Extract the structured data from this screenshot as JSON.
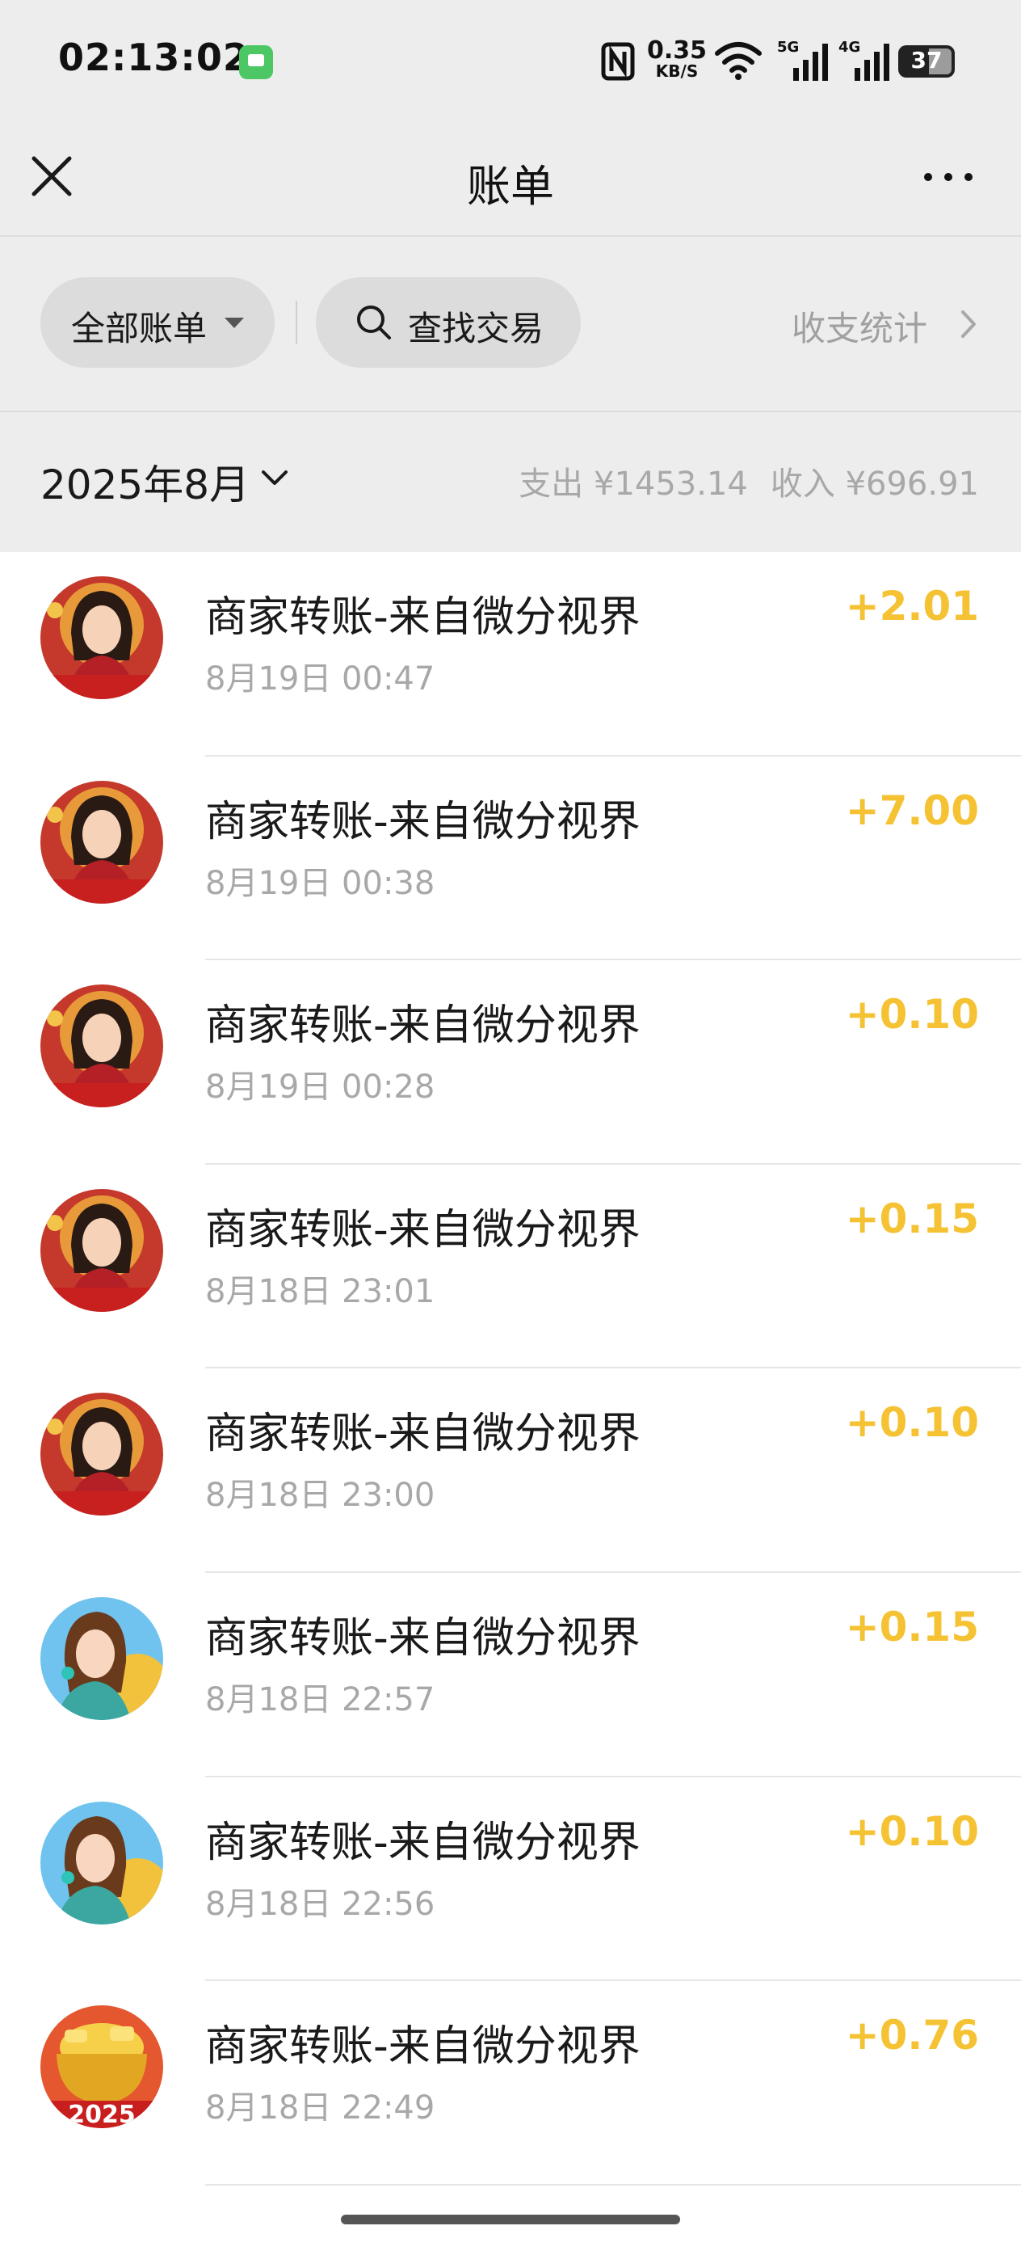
{
  "status_bar": {
    "time": "02:13:02",
    "net_speed_value": "0.35",
    "net_speed_unit": "KB/S",
    "signal_1_label": "5G",
    "signal_2_label": "4G",
    "battery": "37"
  },
  "nav": {
    "title": "账单",
    "close_icon": "close-icon",
    "more_icon": "more-icon"
  },
  "filters": {
    "all_bills_label": "全部账单",
    "search_label": "查找交易",
    "stats_label": "收支统计"
  },
  "month": {
    "label": "2025年8月",
    "expense": "支出 ¥1453.14",
    "income": "收入 ¥696.91"
  },
  "colors": {
    "income_amount": "#f5c234",
    "secondary_text": "#a8a8a8",
    "header_background": "#ededed"
  },
  "transactions": [
    {
      "avatar": "lady-red-avatar",
      "name": "商家转账-来自微分视界",
      "time": "8月19日 00:47",
      "amount": "+2.01"
    },
    {
      "avatar": "lady-red-avatar",
      "name": "商家转账-来自微分视界",
      "time": "8月19日 00:38",
      "amount": "+7.00"
    },
    {
      "avatar": "lady-red-avatar",
      "name": "商家转账-来自微分视界",
      "time": "8月19日 00:28",
      "amount": "+0.10"
    },
    {
      "avatar": "lady-red-avatar",
      "name": "商家转账-来自微分视界",
      "time": "8月18日 23:01",
      "amount": "+0.15"
    },
    {
      "avatar": "lady-red-avatar",
      "name": "商家转账-来自微分视界",
      "time": "8月18日 23:00",
      "amount": "+0.10"
    },
    {
      "avatar": "lady-blue-avatar",
      "name": "商家转账-来自微分视界",
      "time": "8月18日 22:57",
      "amount": "+0.15"
    },
    {
      "avatar": "lady-blue-avatar",
      "name": "商家转账-来自微分视界",
      "time": "8月18日 22:56",
      "amount": "+0.10"
    },
    {
      "avatar": "gold-2025-avatar",
      "name": "商家转账-来自微分视界",
      "time": "8月18日 22:49",
      "amount": "+0.76",
      "avatar_text": "2025"
    }
  ]
}
